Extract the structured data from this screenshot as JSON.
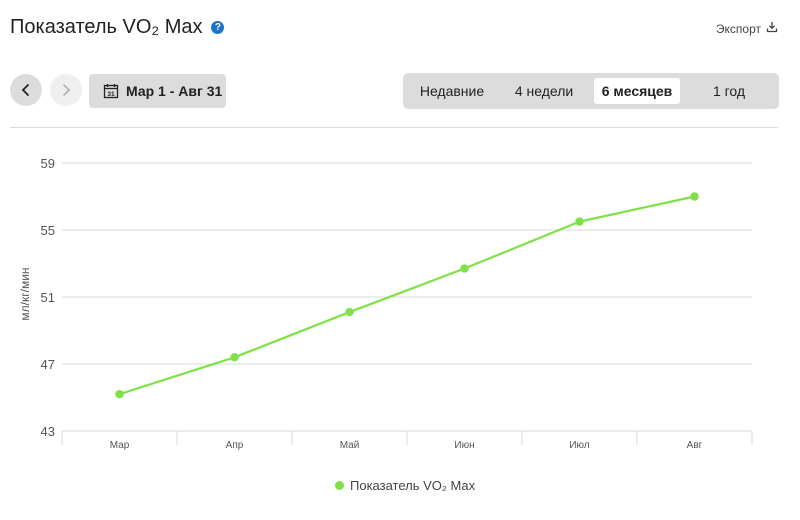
{
  "header": {
    "title": "Показатель VO₂ Max",
    "help_icon": "?",
    "export_label": "Экспорт"
  },
  "toolbar": {
    "date_range": "Мар 1 - Авг 31",
    "calendar_day": "31",
    "tabs": [
      {
        "label": "Недавние",
        "active": false
      },
      {
        "label": "4 недели",
        "active": false
      },
      {
        "label": "6 месяцев",
        "active": true
      },
      {
        "label": "1 год",
        "active": false
      }
    ]
  },
  "colors": {
    "series": "#7ee246",
    "grid": "#d9d9d9",
    "help_icon": "#1a73c8"
  },
  "chart_data": {
    "type": "line",
    "categories": [
      "Мар",
      "Апр",
      "Май",
      "Июн",
      "Июл",
      "Авг"
    ],
    "series": [
      {
        "name": "Показатель VO₂ Max",
        "values": [
          45.2,
          47.4,
          50.1,
          52.7,
          55.5,
          57.0
        ]
      }
    ],
    "yticks": [
      "59",
      "55",
      "51",
      "47",
      "43"
    ],
    "ylim": [
      43,
      59
    ],
    "ylabel": "мл/кг/мин",
    "grid": true,
    "legend": "bottom"
  }
}
